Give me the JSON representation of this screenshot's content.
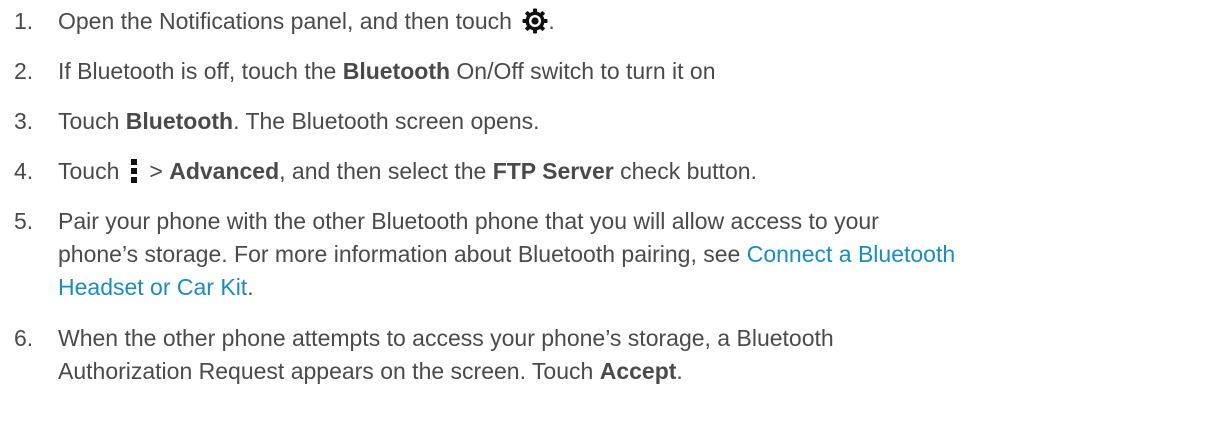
{
  "steps": [
    {
      "num": "1.",
      "before_icon": "Open the Notifications panel, and then touch ",
      "icon": "gear-icon",
      "after_icon": "."
    },
    {
      "num": "2.",
      "text_a": "If Bluetooth is off, touch the ",
      "bold_a": "Bluetooth",
      "text_b": " On/Off switch to turn it on"
    },
    {
      "num": "3.",
      "text_a": "Touch ",
      "bold_a": "Bluetooth",
      "text_b": ". The Bluetooth screen opens."
    },
    {
      "num": "4.",
      "text_a": "Touch",
      "icon": "menu-icon",
      "text_b": "> ",
      "bold_a": "Advanced",
      "text_c": ", and then select the ",
      "bold_b": "FTP Server",
      "text_d": " check button."
    },
    {
      "num": "5.",
      "line1": "Pair your phone with the other Bluetooth phone that you will allow access to your",
      "line2_text": "phone’s storage. For more information about Bluetooth pairing, see ",
      "link_a": "Connect a Bluetooth",
      "link_b": "Headset or Car Kit",
      "after_link": "."
    },
    {
      "num": "6.",
      "line1": "When the other phone attempts to access your phone’s storage, a Bluetooth",
      "line2_text": "Authorization Request appears on the screen. Touch ",
      "bold_a": "Accept",
      "after_bold": "."
    }
  ],
  "colors": {
    "text": "#4a4a4a",
    "link": "#1a8cc0"
  }
}
